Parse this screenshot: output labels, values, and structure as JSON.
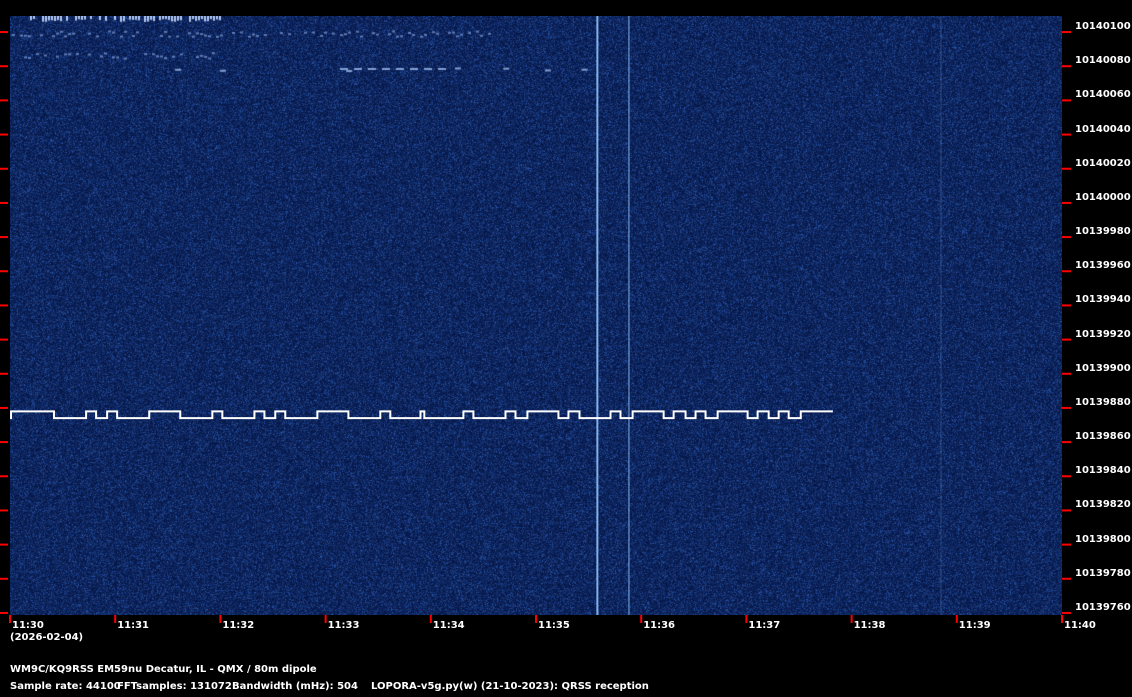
{
  "chart_data": {
    "type": "heatmap",
    "x_tick_labels": [
      "11:30",
      "11:31",
      "11:32",
      "11:33",
      "11:34",
      "11:35",
      "11:36",
      "11:37",
      "11:38",
      "11:39",
      "11:40"
    ],
    "y_tick_labels": [
      "10140100",
      "10140080",
      "10140060",
      "10140040",
      "10140020",
      "10140000",
      "10139980",
      "10139960",
      "10139940",
      "10139920",
      "10139900",
      "10139880",
      "10139860",
      "10139840",
      "10139820",
      "10139800",
      "10139780",
      "10139760"
    ],
    "xlim_minutes": [
      0,
      10
    ],
    "ylim_hz": [
      10139758.8,
      10140109.4
    ],
    "date": "(2026-02-04)",
    "signal": {
      "levels_hz": {
        "low": 10139874,
        "high": 10139878
      },
      "start_level": "low",
      "transitions_s": [
        0.6,
        25.1,
        43.4,
        49.1,
        55.4,
        61.1,
        79.4,
        97.1,
        115.4,
        121.1,
        139.4,
        145.1,
        151.3,
        157.0,
        175.3,
        193.0,
        211.2,
        216.9,
        234.1,
        236.3,
        258.6,
        264.3,
        282.6,
        288.3,
        295.1,
        312.8,
        318.5,
        324.8,
        342.5,
        348.2,
        355.1,
        372.8,
        378.5,
        385.3,
        391.0,
        396.7,
        403.6,
        420.7,
        426.4,
        432.7,
        438.4,
        444.1,
        451.0,
        469.3
      ]
    },
    "vertical_lines_s": [
      {
        "t": 335,
        "intensity": 0.85
      },
      {
        "t": 353,
        "intensity": 0.55
      },
      {
        "t": 531,
        "intensity": 0.15
      }
    ]
  },
  "info": {
    "station": "WM9C/KQ9RSS EM59nu Decatur, IL - QMX / 80m dipole",
    "sample_rate": "Sample rate: 44100",
    "fft_samples": "FFTsamples: 131072",
    "bandwidth": "Bandwidth (mHz): 504",
    "software": "LOPORA-v5g.py(w) (21-10-2023): QRSS reception"
  },
  "colors": {
    "background": "#000000",
    "tick": "#ff0000",
    "noise": "#0a2458",
    "signal": "#ffffff"
  }
}
